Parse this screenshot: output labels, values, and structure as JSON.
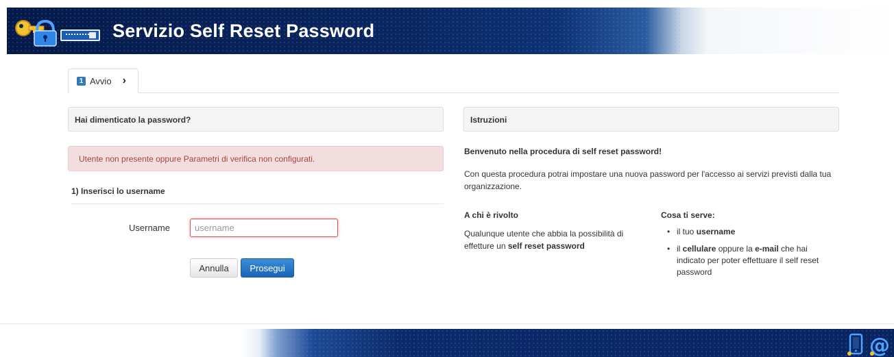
{
  "header": {
    "title": "Servizio Self Reset Password",
    "logo_icon": "key-lock-icon",
    "password_field_icon": "password-field-icon"
  },
  "tabs": [
    {
      "number": "1",
      "label": "Avvio",
      "icon": "chevron-right-icon"
    }
  ],
  "left_panel": {
    "heading": "Hai dimenticato la password?",
    "alert": "Utente non presente oppure Parametri di verifica non configurati.",
    "step_title": "1) Inserisci lo username",
    "username_label": "Username",
    "username_value": "",
    "username_placeholder": "username",
    "cancel_label": "Annulla",
    "continue_label": "Prosegui"
  },
  "right_panel": {
    "heading": "Istruzioni",
    "welcome": "Benvenuto nella procedura di self reset password!",
    "intro": "Con questa procedura potrai impostare una nuova password per l'accesso ai servizi previsti dalla tua organizzazione.",
    "target_title": "A chi è rivolto",
    "target_text_prefix": "Qualunque utente che abbia la possibilità di effetture un ",
    "target_text_bold": "self reset password",
    "needs_title": "Cosa ti serve:",
    "needs": [
      {
        "prefix": "il tuo ",
        "bold": "username",
        "middle": "",
        "bold2": "",
        "suffix": ""
      },
      {
        "prefix": "il ",
        "bold": "cellulare",
        "middle": " oppure la ",
        "bold2": "e-mail",
        "suffix": " che hai indicato per poter effettuare il self reset password"
      }
    ]
  },
  "footer": {
    "icons": [
      "mobile-phone-icon",
      "at-email-icon"
    ]
  },
  "colors": {
    "brand_dark": "#0a2460",
    "primary_button": "#1a63b6",
    "alert_bg": "#f2dede",
    "alert_text": "#a94442",
    "error_border": "#d9534f"
  }
}
